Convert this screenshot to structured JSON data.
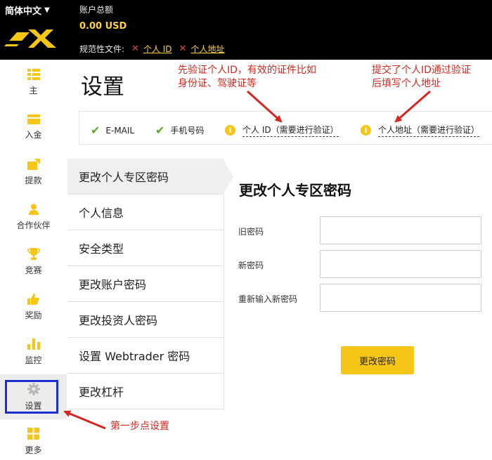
{
  "header": {
    "language": "简体中文",
    "balance_label": "账户总额",
    "balance_value": "0.00 USD",
    "docs_label": "规范性文件:",
    "docs": [
      "个人 ID",
      "个人地址"
    ]
  },
  "sidebar": {
    "items": [
      {
        "label": "主",
        "icon": "list-icon"
      },
      {
        "label": "入金",
        "icon": "wallet-icon"
      },
      {
        "label": "提款",
        "icon": "withdraw-icon"
      },
      {
        "label": "合作伙伴",
        "icon": "person-icon"
      },
      {
        "label": "竞赛",
        "icon": "trophy-icon"
      },
      {
        "label": "奖励",
        "icon": "thumbs-up-icon"
      },
      {
        "label": "监控",
        "icon": "bar-chart-icon"
      },
      {
        "label": "设置",
        "icon": "gear-icon"
      },
      {
        "label": "更多",
        "icon": "grid-icon"
      }
    ]
  },
  "page": {
    "title": "设置"
  },
  "verification": {
    "email": "E-MAIL",
    "phone": "手机号码",
    "id": "个人 ID（需要进行验证）",
    "address": "个人地址（需要进行验证）"
  },
  "menu": {
    "items": [
      "更改个人专区密码",
      "个人信息",
      "安全类型",
      "更改账户密码",
      "更改投资人密码",
      "设置 Webtrader 密码",
      "更改杠杆"
    ]
  },
  "form": {
    "title": "更改个人专区密码",
    "old_password": "旧密码",
    "new_password": "新密码",
    "repeat_password": "重新输入新密码",
    "submit": "更改密码"
  },
  "annotations": {
    "note1_line1": "先验证个人ID，有效的证件比如",
    "note1_line2": "身份证、驾驶证等",
    "note2_line1": "提交了个人ID通过验证",
    "note2_line2": "后填写个人地址",
    "note3": "第一步点设置"
  },
  "colors": {
    "accent": "#f5c518",
    "link": "#ffd23a",
    "annotation": "#d6261e",
    "verified": "#5ca72f",
    "highlight_box": "#1a2fd0"
  }
}
